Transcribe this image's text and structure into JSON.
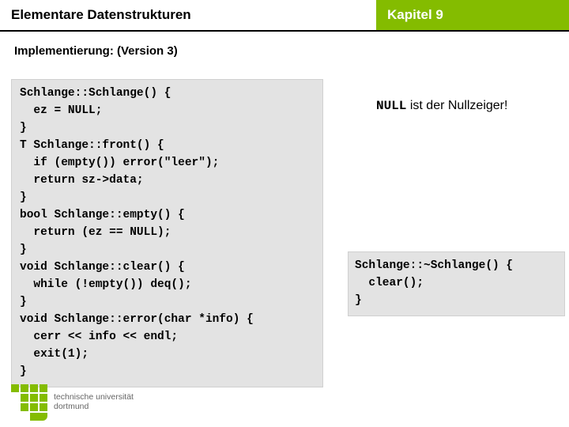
{
  "header": {
    "left": "Elementare Datenstrukturen",
    "right": "Kapitel 9"
  },
  "impl": "Implementierung: (Version 3)",
  "code_main": "Schlange::Schlange() {\n  ez = NULL;\n}\nT Schlange::front() {\n  if (empty()) error(\"leer\");\n  return sz->data;\n}\nbool Schlange::empty() {\n  return (ez == NULL);\n}\nvoid Schlange::clear() {\n  while (!empty()) deq();\n}\nvoid Schlange::error(char *info) {\n  cerr << info << endl;\n  exit(1);\n}",
  "note": {
    "null": "NULL",
    "rest": " ist der Nullzeiger!"
  },
  "code_side": "Schlange::~Schlange() {\n  clear();\n}",
  "uni": {
    "line1": "technische universität",
    "line2": "dortmund"
  }
}
